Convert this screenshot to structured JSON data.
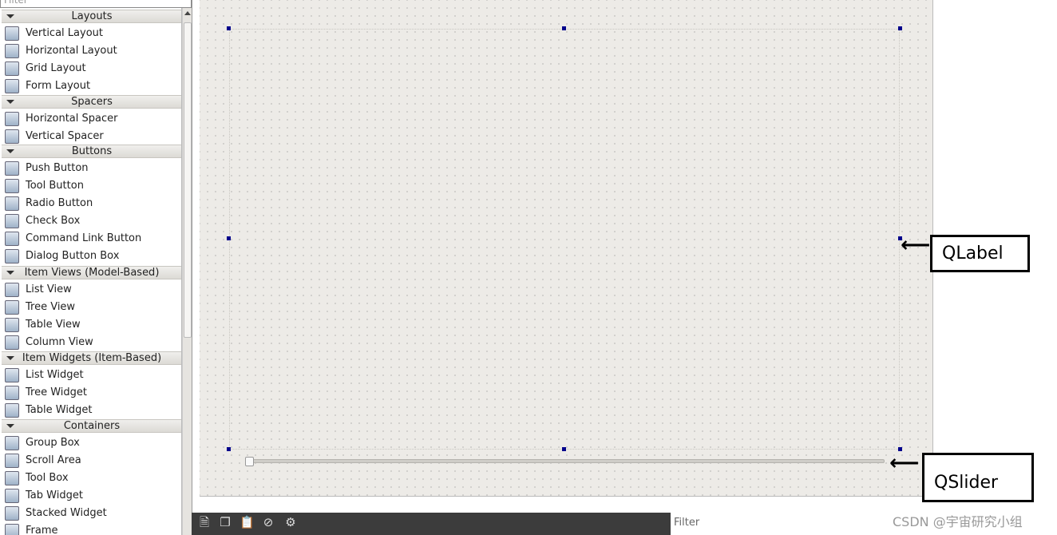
{
  "widget_box": {
    "filter_placeholder": "Filter",
    "groups": [
      {
        "title": "Layouts",
        "items": [
          "Vertical Layout",
          "Horizontal Layout",
          "Grid Layout",
          "Form Layout"
        ]
      },
      {
        "title": "Spacers",
        "items": [
          "Horizontal Spacer",
          "Vertical Spacer"
        ]
      },
      {
        "title": "Buttons",
        "items": [
          "Push Button",
          "Tool Button",
          "Radio Button",
          "Check Box",
          "Command Link Button",
          "Dialog Button Box"
        ]
      },
      {
        "title": "Item Views (Model-Based)",
        "items": [
          "List View",
          "Tree View",
          "Table View",
          "Column View"
        ]
      },
      {
        "title": "Item Widgets (Item-Based)",
        "items": [
          "List Widget",
          "Tree Widget",
          "Table Widget"
        ]
      },
      {
        "title": "Containers",
        "items": [
          "Group Box",
          "Scroll Area",
          "Tool Box",
          "Tab Widget",
          "Stacked Widget",
          "Frame"
        ]
      }
    ]
  },
  "form": {
    "slider_value_fraction": 0
  },
  "bottom": {
    "filter_placeholder": "Filter",
    "toolbar_icons": [
      "new-icon",
      "copy-icon",
      "paste-icon",
      "delete-icon",
      "settings-icon"
    ]
  },
  "annotations": {
    "label": "QLabel",
    "slider": "QSlider"
  },
  "watermark": "CSDN @宇宙研究小组"
}
